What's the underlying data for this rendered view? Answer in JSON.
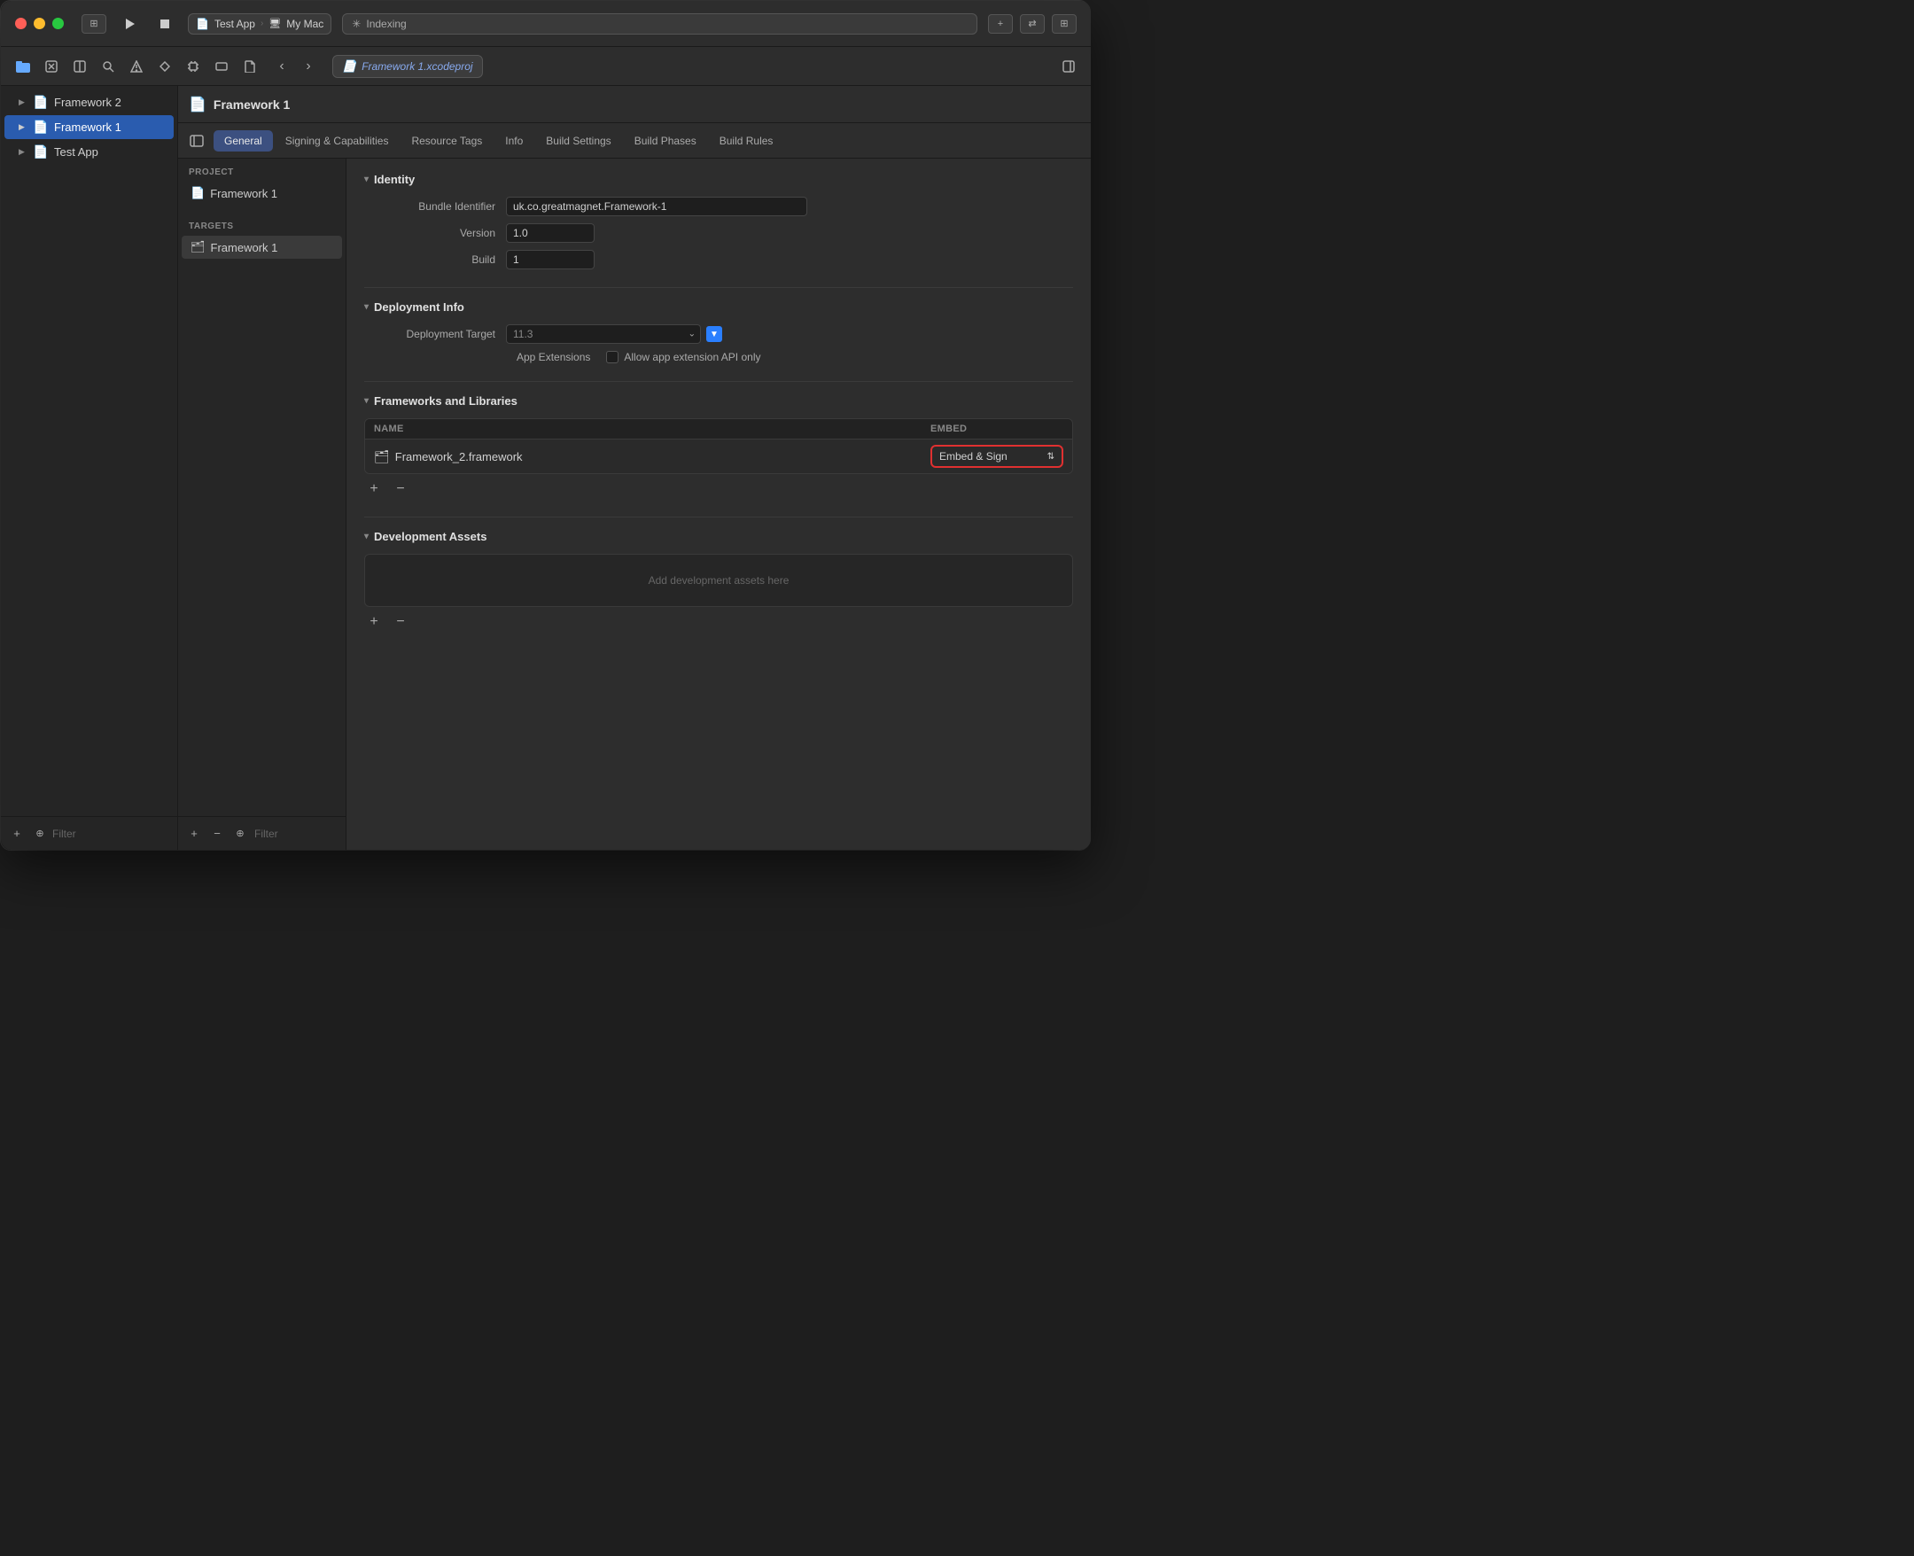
{
  "window": {
    "title": "Framework 1.xcodeproj"
  },
  "titlebar": {
    "run_label": "▶",
    "stop_label": "■",
    "target": "Test App",
    "destination": "My Mac",
    "indexing_label": "Indexing",
    "plus_label": "+",
    "expand_label": "⇄",
    "panels_label": "⊞"
  },
  "toolbar": {
    "icons": [
      "folder-fill",
      "xmark-square",
      "square-split",
      "magnifyingglass",
      "exclamationmark-triangle",
      "diamond",
      "cpu",
      "rectangle",
      "doc"
    ],
    "back_label": "‹",
    "forward_label": "›",
    "tab_file_label": "Framework 1.xcodeproj",
    "panels_right_label": "⊡"
  },
  "sidebar": {
    "items": [
      {
        "label": "Framework 2",
        "icon": "📄",
        "chevron": "▶",
        "selected": false
      },
      {
        "label": "Framework 1",
        "icon": "📄",
        "chevron": "▶",
        "selected": true
      },
      {
        "label": "Test App",
        "icon": "📄",
        "chevron": "▶",
        "selected": false
      }
    ],
    "footer": {
      "add_label": "+",
      "badge_label": "⊕",
      "filter_placeholder": "Filter"
    }
  },
  "project_panel": {
    "project_section_label": "PROJECT",
    "project_item": {
      "label": "Framework 1",
      "icon": "📄"
    },
    "targets_section_label": "TARGETS",
    "target_item": {
      "label": "Framework 1",
      "icon": "🗂"
    },
    "footer": {
      "add_label": "+",
      "remove_label": "−",
      "filter_icon": "⊕",
      "filter_placeholder": "Filter"
    }
  },
  "content": {
    "header": {
      "icon": "📄",
      "title": "Framework 1"
    },
    "tabs": [
      {
        "label": "General",
        "active": true
      },
      {
        "label": "Signing & Capabilities",
        "active": false
      },
      {
        "label": "Resource Tags",
        "active": false
      },
      {
        "label": "Info",
        "active": false
      },
      {
        "label": "Build Settings",
        "active": false
      },
      {
        "label": "Build Phases",
        "active": false
      },
      {
        "label": "Build Rules",
        "active": false
      }
    ],
    "identity": {
      "section_label": "Identity",
      "bundle_identifier_label": "Bundle Identifier",
      "bundle_identifier_value": "uk.co.greatmagnet.Framework-1",
      "version_label": "Version",
      "version_value": "1.0",
      "build_label": "Build",
      "build_value": "1"
    },
    "deployment": {
      "section_label": "Deployment Info",
      "target_label": "Deployment Target",
      "target_value": "11.3",
      "app_extensions_label": "App Extensions",
      "app_extensions_checkbox": false,
      "app_extensions_text": "Allow app extension API only"
    },
    "frameworks": {
      "section_label": "Frameworks and Libraries",
      "col_name": "Name",
      "col_embed": "Embed",
      "items": [
        {
          "name": "Framework_2.framework",
          "icon": "🗂",
          "embed_value": "Embed & Sign"
        }
      ],
      "add_label": "+",
      "remove_label": "−"
    },
    "development_assets": {
      "section_label": "Development Assets",
      "placeholder": "Add development assets here",
      "add_label": "+",
      "remove_label": "−"
    }
  }
}
